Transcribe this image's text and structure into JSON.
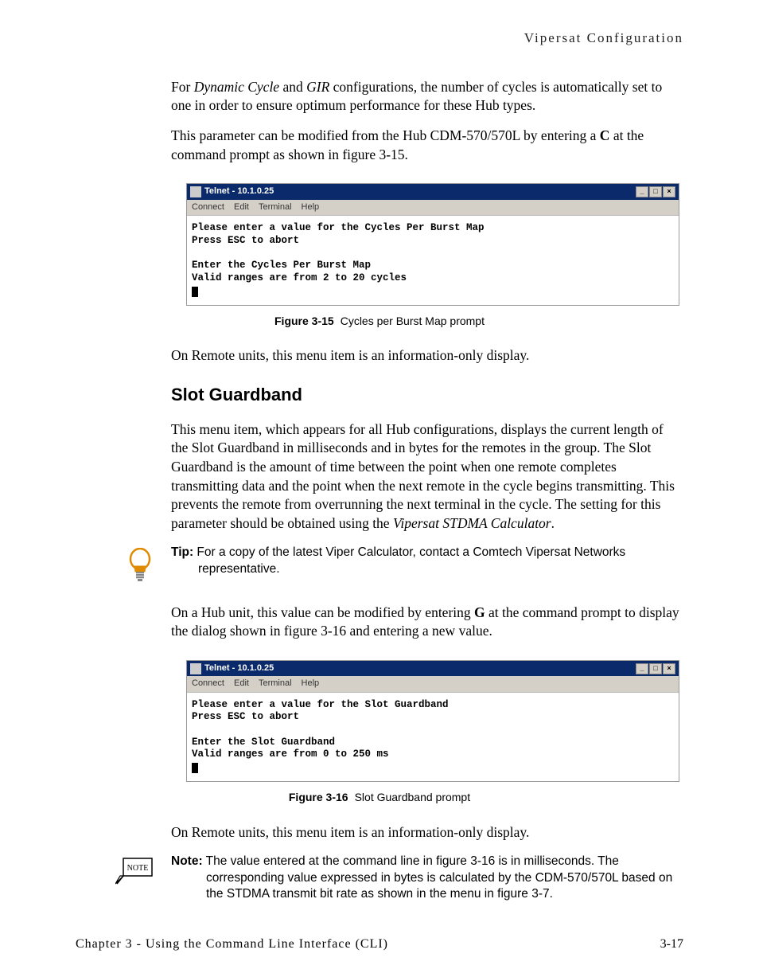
{
  "header": {
    "running_head": "Vipersat Configuration"
  },
  "para1_pre": "For ",
  "para1_italic1": "Dynamic Cycle",
  "para1_mid1": " and ",
  "para1_italic2": "GIR",
  "para1_post": " configurations, the number of cycles is automatically set to one in order to ensure optimum performance for these Hub types.",
  "para2_pre": "This parameter can be modified from the Hub CDM-570/570L by entering a ",
  "para2_bold": "C",
  "para2_post": " at the command prompt as shown in figure 3-15.",
  "telnet1": {
    "title": "Telnet - 10.1.0.25",
    "menu": {
      "m1": "Connect",
      "m2": "Edit",
      "m3": "Terminal",
      "m4": "Help"
    },
    "body": "Please enter a value for the Cycles Per Burst Map\nPress ESC to abort\n\nEnter the Cycles Per Burst Map\nValid ranges are from 2 to 20 cycles"
  },
  "fig1": {
    "label": "Figure 3-15",
    "text": "Cycles per Burst Map prompt"
  },
  "para3": "On Remote units, this menu item is an information-only display.",
  "heading1": "Slot Guardband",
  "para4_pre": "This menu item, which appears for all Hub configurations, displays the current length of the Slot Guardband in milliseconds and in bytes for the remotes in the group. The Slot Guardband is the amount of time between the point when one remote completes transmitting data and the point when the next remote in the cycle begins transmitting. This prevents the remote from overrunning the next terminal in the cycle. The setting for this parameter should be obtained using the ",
  "para4_italic": "Vipersat STDMA Calculator",
  "para4_post": ".",
  "tip": {
    "label": "Tip:",
    "text": " For a copy of the latest Viper Calculator, contact a Comtech Vipersat Networks representative."
  },
  "para5_pre": "On a Hub unit, this value can be modified by entering ",
  "para5_bold": "G",
  "para5_post": " at the command prompt to display the dialog shown in figure 3-16 and entering a new value.",
  "telnet2": {
    "title": "Telnet - 10.1.0.25",
    "menu": {
      "m1": "Connect",
      "m2": "Edit",
      "m3": "Terminal",
      "m4": "Help"
    },
    "body": "Please enter a value for the Slot Guardband\nPress ESC to abort\n\nEnter the Slot Guardband\nValid ranges are from 0 to 250 ms"
  },
  "fig2": {
    "label": "Figure 3-16",
    "text": "Slot Guardband prompt"
  },
  "para6": "On Remote units, this menu item is an information-only display.",
  "note": {
    "label": "Note:",
    "box": "NOTE",
    "text": " The value entered at the command line in figure 3-16 is in milliseconds. The corresponding value expressed in bytes is calculated by the CDM-570/570L based on the STDMA transmit bit rate as shown in the menu in figure 3-7."
  },
  "footer": {
    "left": "Chapter 3 - Using the Command Line Interface (CLI)",
    "right": "3-17"
  },
  "window_controls": {
    "min": "_",
    "max": "□",
    "close": "×"
  }
}
